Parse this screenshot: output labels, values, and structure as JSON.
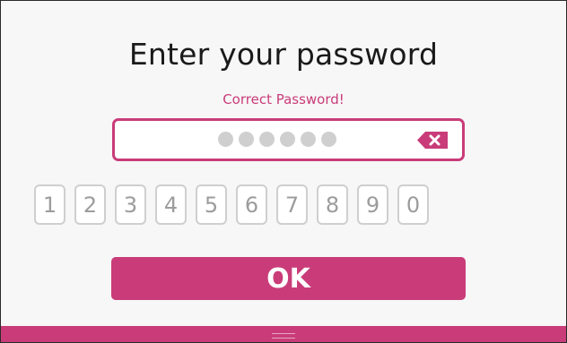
{
  "dialog": {
    "title": "Enter your password",
    "status_message": "Correct Password!"
  },
  "password_field": {
    "masked_length": 6,
    "clear_icon": "backspace-x-icon"
  },
  "keypad": {
    "keys": [
      "1",
      "2",
      "3",
      "4",
      "5",
      "6",
      "7",
      "8",
      "9",
      "0"
    ]
  },
  "actions": {
    "ok_label": "OK"
  },
  "colors": {
    "accent": "#c93c79",
    "key_border": "#cfcfcf",
    "key_text": "#9c9c9c",
    "dot": "#cfcfcf"
  }
}
